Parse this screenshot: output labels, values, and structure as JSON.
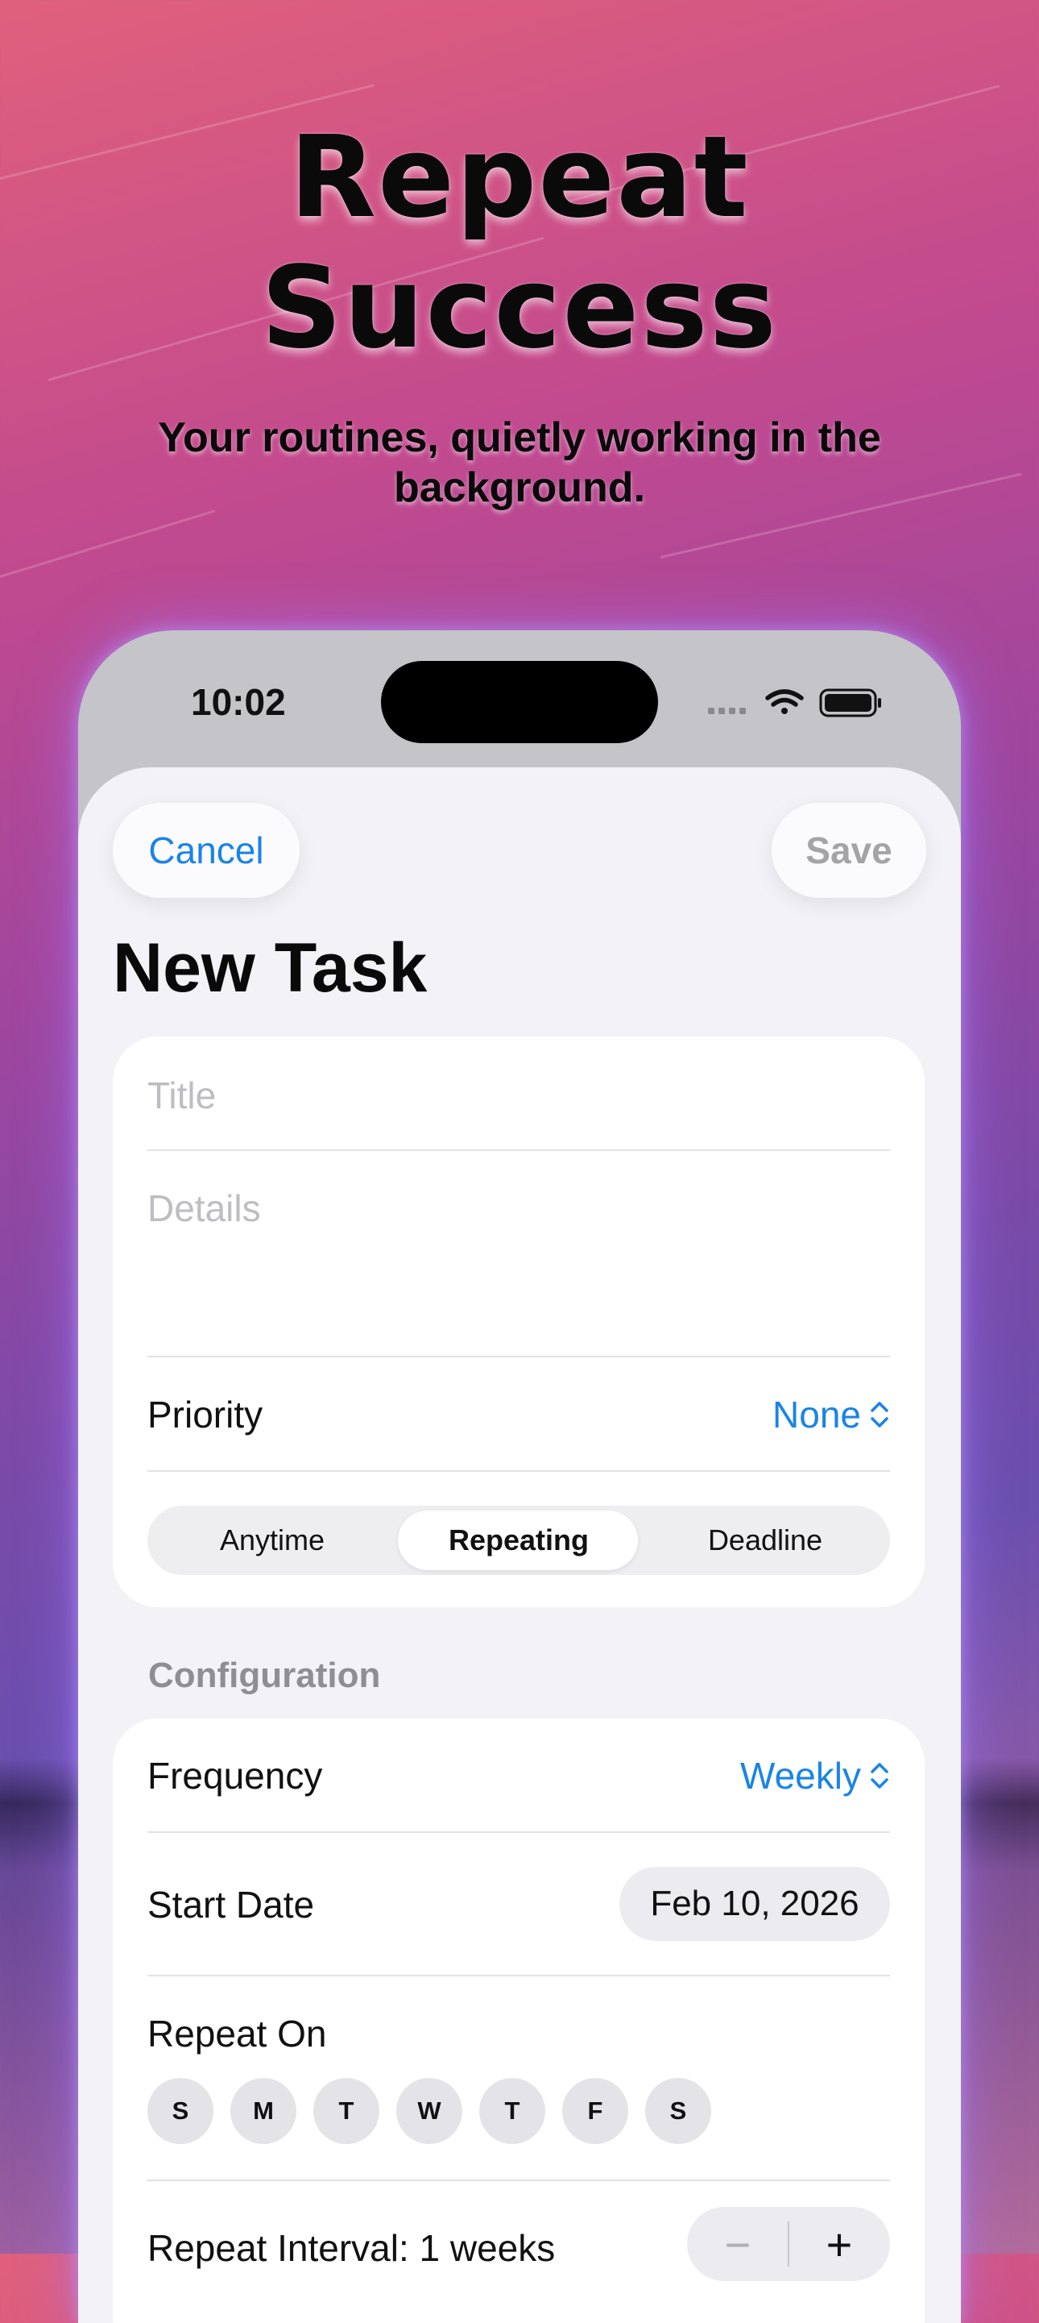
{
  "hero": {
    "title_line1": "Repeat",
    "title_line2": "Success",
    "subtitle": "Your routines, quietly working in the background."
  },
  "status_bar": {
    "time": "10:02",
    "icons": [
      "signal-icon",
      "wifi-icon",
      "battery-icon"
    ]
  },
  "nav": {
    "cancel_label": "Cancel",
    "save_label": "Save",
    "title": "New Task"
  },
  "form": {
    "title_placeholder": "Title",
    "details_placeholder": "Details",
    "priority_label": "Priority",
    "priority_value": "None",
    "task_types": [
      "Anytime",
      "Repeating",
      "Deadline"
    ],
    "selected_task_type": "Repeating"
  },
  "configuration": {
    "section_label": "Configuration",
    "frequency_label": "Frequency",
    "frequency_value": "Weekly",
    "start_date_label": "Start Date",
    "start_date_value": "Feb 10, 2026",
    "repeat_on_label": "Repeat On",
    "days": [
      "S",
      "M",
      "T",
      "W",
      "T",
      "F",
      "S"
    ],
    "repeat_interval_label": "Repeat Interval: 1 weeks",
    "stepper_minus": "−",
    "stepper_plus": "+"
  },
  "colors": {
    "accent": "#1a84e6",
    "sheet_background": "#f2f2f7",
    "placeholder": "#bdbdc2"
  }
}
